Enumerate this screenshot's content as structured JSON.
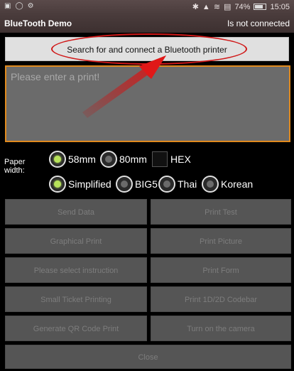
{
  "status_bar": {
    "left_icons": [
      "gallery-icon",
      "circle-icon",
      "settings-icon"
    ],
    "right_icons": [
      "bluetooth-icon",
      "signal-icon",
      "wifi-icon",
      "sim-icon"
    ],
    "battery": "74%",
    "time": "15:05"
  },
  "title_bar": {
    "title": "BlueTooth Demo",
    "connection_status": "Is not connected"
  },
  "search_button": {
    "label": "Search for and connect a Bluetooth printer"
  },
  "print_input": {
    "placeholder": "Please enter a print!"
  },
  "paper_width": {
    "label": "Paper width:",
    "options": [
      {
        "label": "58mm",
        "selected": true
      },
      {
        "label": "80mm",
        "selected": false
      }
    ],
    "hex_label": "HEX"
  },
  "encoding": {
    "options": [
      {
        "label": "Simplified",
        "selected": true
      },
      {
        "label": "BIG5",
        "selected": false
      },
      {
        "label": "Thai",
        "selected": false
      },
      {
        "label": "Korean",
        "selected": false
      }
    ]
  },
  "buttons": {
    "send_data": "Send Data",
    "print_test": "Print Test",
    "graphical_print": "Graphical Print",
    "print_picture": "Print Picture",
    "select_instruction": "Please select instruction",
    "print_form": "Print Form",
    "small_ticket": "Small Ticket Printing",
    "print_codebar": "Print 1D/2D Codebar",
    "qr_code": "Generate QR Code Print",
    "camera": "Turn on the camera",
    "close": "Close"
  },
  "colors": {
    "accent": "#e08a1e",
    "annotation": "#d01818",
    "radio_selected": "#b7e25a"
  }
}
